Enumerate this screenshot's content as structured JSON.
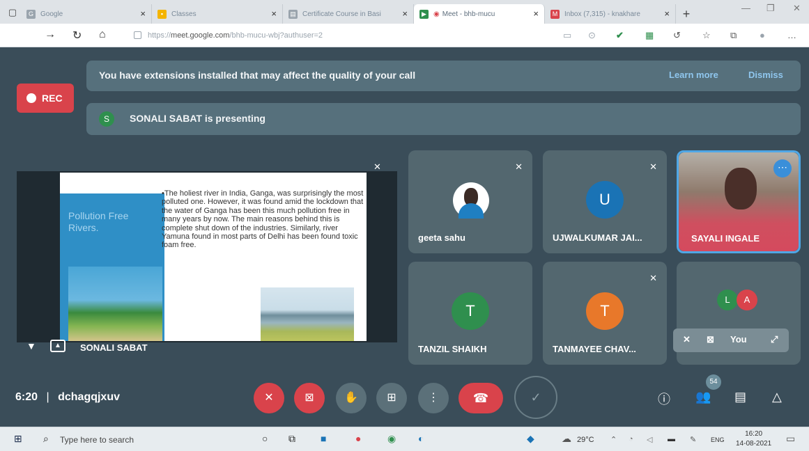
{
  "browser": {
    "tabs": [
      {
        "label": "Google",
        "active": false
      },
      {
        "label": "Classes",
        "active": false
      },
      {
        "label": "Certificate Course in Basi",
        "active": false
      },
      {
        "label": "Meet - bhb-mucu",
        "active": true
      },
      {
        "label": "Inbox (7,315) - knakhare",
        "active": false
      }
    ],
    "new_tab": "+",
    "url_prefix": "https://",
    "url_host": "meet.google.com",
    "url_path": "/bhb-mucu-wbj?authuser=2"
  },
  "meet": {
    "extension_banner": "You have extensions installed that may affect the quality of your call",
    "learn_more": "Learn more",
    "dismiss": "Dismiss",
    "rec_label": "REC",
    "presenting_initial": "S",
    "presenting_text": "SONALI SABAT is presenting",
    "presenter_name": "SONALI SABAT",
    "slide": {
      "title": "Pollution Free Rivers.",
      "body": "•The holiest river in India, Ganga, was surprisingly the most polluted one. However, it was found amid the lockdown that the water of Ganga has been this much pollution free in many years by now. The main reasons behind this is complete shut down of the industries. Similarly, river Yamuna found in most parts of Delhi has been found toxic foam free."
    },
    "participants": [
      {
        "name": "geeta sahu",
        "initial": "",
        "color": "#ffffff"
      },
      {
        "name": "UJWALKUMAR JAI...",
        "initial": "U",
        "color": "#1a73b5"
      },
      {
        "name": "SAYALI INGALE",
        "initial": "",
        "color": "#cf4f5f"
      },
      {
        "name": "TANZIL SHAIKH",
        "initial": "T",
        "color": "#2f8f4e"
      },
      {
        "name": "TANMAYEE CHAV...",
        "initial": "T",
        "color": "#e8782a"
      }
    ],
    "self_tile": {
      "initials": [
        "L",
        "A"
      ],
      "colors": [
        "#2f8f4e",
        "#d9434b"
      ],
      "label": "You"
    },
    "time": "6:20",
    "meeting_code": "dchagqjxuv",
    "people_count": "54"
  },
  "taskbar": {
    "search_placeholder": "Type here to search",
    "temperature": "29°C",
    "language": "ENG",
    "time": "16:20",
    "date": "14-08-2021"
  }
}
